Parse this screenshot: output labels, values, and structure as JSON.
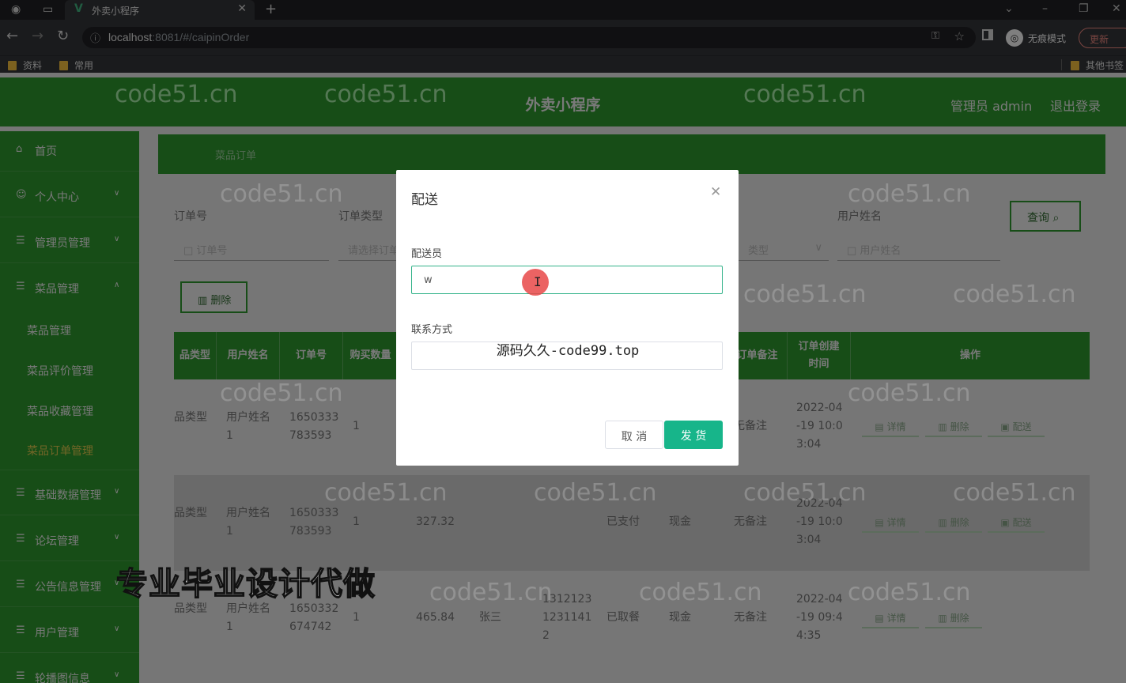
{
  "browser": {
    "tab_title": "外卖小程序",
    "tab_logo": "V",
    "url_host": "localhost",
    "url_rest": ":8081/#/caipinOrder",
    "incognito_label": "无痕模式",
    "update_label": "更新",
    "bookmarks": [
      "资料",
      "常用"
    ],
    "other_bookmarks": "其他书签"
  },
  "header": {
    "title": "外卖小程序",
    "admin": "管理员 admin",
    "logout": "退出登录"
  },
  "sidebar": {
    "items": [
      {
        "label": "首页",
        "icon": "home-icon"
      },
      {
        "label": "个人中心",
        "icon": "user-icon"
      },
      {
        "label": "管理员管理",
        "icon": "admin-icon"
      },
      {
        "label": "菜品管理",
        "icon": "dish-icon"
      },
      {
        "label": "菜品管理"
      },
      {
        "label": "菜品评价管理"
      },
      {
        "label": "菜品收藏管理"
      },
      {
        "label": "菜品订单管理"
      },
      {
        "label": "基础数据管理",
        "icon": "data-icon"
      },
      {
        "label": "论坛管理",
        "icon": "forum-icon"
      },
      {
        "label": "公告信息管理",
        "icon": "notice-icon"
      },
      {
        "label": "用户管理",
        "icon": "users-icon"
      },
      {
        "label": "轮播图信息",
        "icon": "carousel-icon"
      }
    ]
  },
  "breadcrumb": {
    "text": "菜品订单"
  },
  "search": {
    "order_no_label": "订单号",
    "order_no_placeholder": "订单号",
    "order_type_label": "订单类型",
    "order_type_placeholder": "请选择订单",
    "third_placeholder": "类型",
    "user_name_label": "用户姓名",
    "user_name_placeholder": "用户姓名",
    "query_label": "查询",
    "delete_label": "删除"
  },
  "table": {
    "headers": [
      "品类型",
      "用户姓名",
      "订单号",
      "购买数量",
      "订单备注",
      "订单创建\n时间",
      "操作"
    ],
    "rows": [
      {
        "type": "品类型",
        "user": "用户姓名\n1",
        "order_no": "1650333\n783593",
        "qty": "1",
        "price": "",
        "courier": "",
        "phone": "",
        "status": "",
        "pay": "",
        "note": "无备注",
        "time": "2022-04\n-19 10:0\n3:04",
        "ops": [
          "详情",
          "删除",
          "配送"
        ]
      },
      {
        "type": "品类型",
        "user": "用户姓名\n1",
        "order_no": "1650333\n783593",
        "qty": "1",
        "price": "327.32",
        "courier": "",
        "phone": "",
        "status": "已支付",
        "pay": "现金",
        "note": "无备注",
        "time": "2022-04\n-19 10:0\n3:04",
        "ops": [
          "详情",
          "删除",
          "配送"
        ]
      },
      {
        "type": "品类型",
        "user": "用户姓名\n1",
        "order_no": "1650332\n674742",
        "qty": "1",
        "price": "465.84",
        "courier": "张三",
        "phone": "1312123\n1231141\n2",
        "status": "已取餐",
        "pay": "现金",
        "note": "无备注",
        "time": "2022-04\n-19 09:4\n4:35",
        "ops": [
          "详情",
          "删除"
        ]
      }
    ]
  },
  "dialog": {
    "title": "配送",
    "courier_label": "配送员",
    "courier_value": "w",
    "phone_label": "联系方式",
    "phone_value": "源码久久-code99.top",
    "cancel_label": "取 消",
    "ship_label": "发 货"
  },
  "overlay_text": {
    "watermark": "code51.cn",
    "promo": "专业毕业设计代做"
  },
  "colors": {
    "primary_green": "#2f9a2f",
    "ship_button": "#17b58a",
    "active_menu": "#e6cc4f"
  }
}
